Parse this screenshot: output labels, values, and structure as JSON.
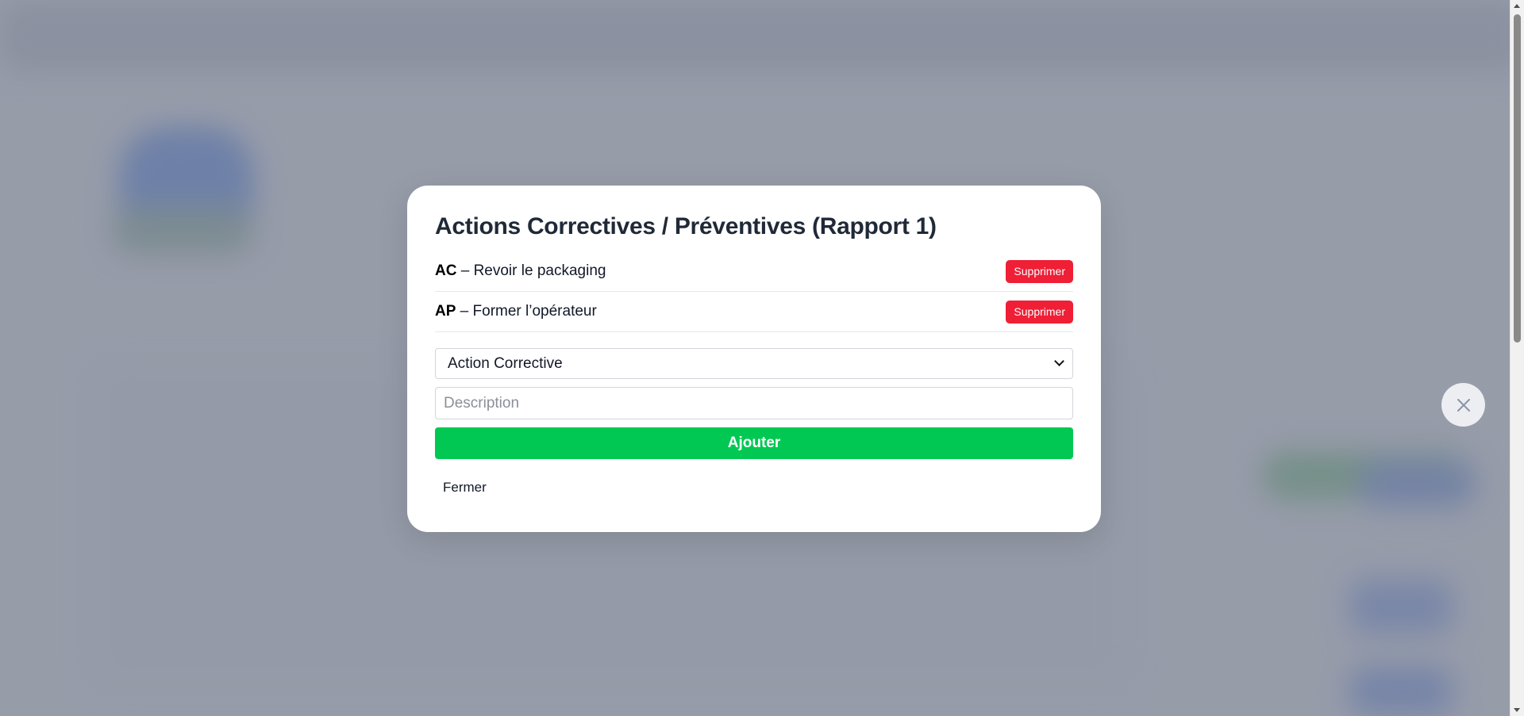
{
  "modal": {
    "title": "Actions Correctives / Préventives (Rapport 1)",
    "actions": [
      {
        "code": "AC",
        "separator": " – ",
        "description": "Revoir le packaging",
        "delete_label": "Supprimer"
      },
      {
        "code": "AP",
        "separator": " – ",
        "description": "Former l’opérateur",
        "delete_label": "Supprimer"
      }
    ],
    "type_select": {
      "selected": "Action Corrective"
    },
    "description_input": {
      "value": "",
      "placeholder": "Description"
    },
    "add_label": "Ajouter",
    "close_label": "Fermer"
  },
  "floating_close": {
    "icon": "close-icon"
  },
  "colors": {
    "delete_button": "#ef1f36",
    "add_button": "#00c853",
    "title_text": "#1f2937",
    "overlay": "#6e7587"
  }
}
